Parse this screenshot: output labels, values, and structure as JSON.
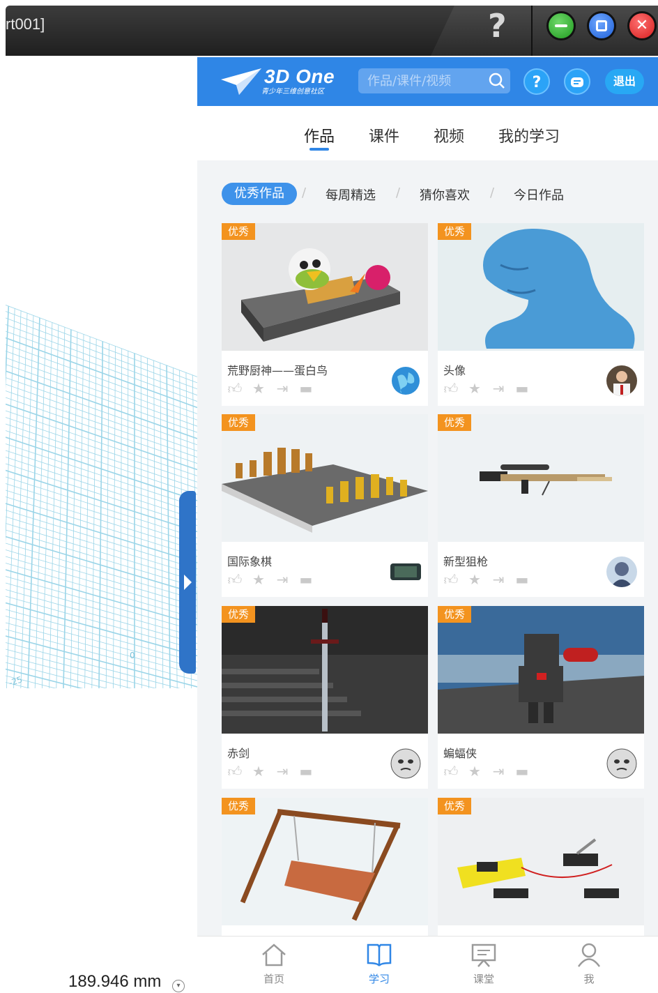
{
  "window": {
    "title": "rt001]",
    "help_glyph": "?"
  },
  "canvas": {
    "grid_labels": [
      "0",
      "-25"
    ],
    "measurement": "189.946 mm"
  },
  "header": {
    "logo_text": "3D One",
    "logo_subtitle": "青少年三维创意社区",
    "search_placeholder": "作品/课件/视频",
    "logout_label": "退出"
  },
  "tabs": [
    {
      "label": "作品",
      "active": true
    },
    {
      "label": "课件",
      "active": false
    },
    {
      "label": "视频",
      "active": false
    },
    {
      "label": "我的学习",
      "active": false
    }
  ],
  "filters": [
    {
      "label": "优秀作品",
      "active": true
    },
    {
      "label": "每周精选",
      "active": false
    },
    {
      "label": "猜你喜欢",
      "active": false
    },
    {
      "label": "今日作品",
      "active": false
    }
  ],
  "filter_separator": "/",
  "badge_label": "优秀",
  "cards": [
    {
      "title": "荒野厨神——蛋白鸟",
      "badge": "优秀",
      "thumb": "chef-bird",
      "avatar": "globe"
    },
    {
      "title": "头像",
      "badge": "优秀",
      "thumb": "head-bust",
      "avatar": "person"
    },
    {
      "title": "国际象棋",
      "badge": "优秀",
      "thumb": "chess",
      "avatar": "dark-rect"
    },
    {
      "title": "新型狙枪",
      "badge": "优秀",
      "thumb": "sniper",
      "avatar": "character"
    },
    {
      "title": "赤剑",
      "badge": "优秀",
      "thumb": "sword",
      "avatar": "face"
    },
    {
      "title": "蝙蝠侠",
      "badge": "优秀",
      "thumb": "batman",
      "avatar": "face"
    },
    {
      "title": "",
      "badge": "优秀",
      "thumb": "swing",
      "avatar": ""
    },
    {
      "title": "",
      "badge": "优秀",
      "thumb": "circuit",
      "avatar": ""
    }
  ],
  "bottom_nav": [
    {
      "label": "首页",
      "icon": "home-icon",
      "active": false
    },
    {
      "label": "学习",
      "icon": "book-icon",
      "active": true
    },
    {
      "label": "课堂",
      "icon": "classroom-icon",
      "active": false
    },
    {
      "label": "我",
      "icon": "user-icon",
      "active": false
    }
  ],
  "colors": {
    "accent": "#2f86e6",
    "badge": "#f3931f",
    "grid": "#8fd2e6"
  }
}
